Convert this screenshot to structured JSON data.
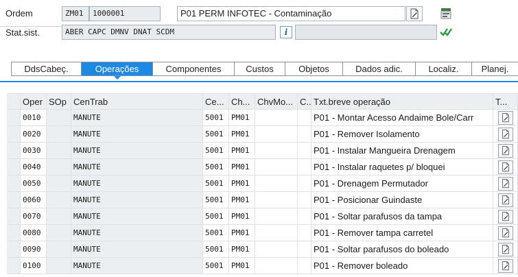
{
  "header": {
    "ordem_label": "Ordem",
    "order_type": "ZM01",
    "order_number": "1000001",
    "order_description": "P01 PERM INFOTEC - Contaminação",
    "status_label": "Stat.sist.",
    "system_status": "ABER CAPC DMNV DNAT SCDM",
    "info_icon_glyph": "i"
  },
  "tabs": [
    {
      "label": "DdsCabeç.",
      "active": false
    },
    {
      "label": "Operações",
      "active": true
    },
    {
      "label": "Componentes",
      "active": false
    },
    {
      "label": "Custos",
      "active": false
    },
    {
      "label": "Objetos",
      "active": false
    },
    {
      "label": "Dados adic.",
      "active": false
    },
    {
      "label": "Localiz.",
      "active": false
    },
    {
      "label": "Planej.",
      "active": false
    }
  ],
  "grid": {
    "columns": {
      "oper": "Oper",
      "sop": "SOp",
      "centrab": "CenTrab",
      "ce": "Ce...",
      "ch": "Ch...",
      "chvmo": "ChvMo...",
      "c": "C...",
      "txt": "Txt.breve operação",
      "t": "T..."
    },
    "rows": [
      {
        "oper": "0010",
        "centrab": "MANUTE",
        "ce": "5001",
        "ch": "PM01",
        "txt": "P01 - Montar Acesso Andaime Bole/Carr"
      },
      {
        "oper": "0020",
        "centrab": "MANUTE",
        "ce": "5001",
        "ch": "PM01",
        "txt": "P01 - Remover Isolamento"
      },
      {
        "oper": "0030",
        "centrab": "MANUTE",
        "ce": "5001",
        "ch": "PM01",
        "txt": "P01 - Instalar Mangueira Drenagem"
      },
      {
        "oper": "0040",
        "centrab": "MANUTE",
        "ce": "5001",
        "ch": "PM01",
        "txt": "P01 - Instalar raquetes p/ bloquei"
      },
      {
        "oper": "0050",
        "centrab": "MANUTE",
        "ce": "5001",
        "ch": "PM01",
        "txt": "P01 - Drenagem Permutador"
      },
      {
        "oper": "0060",
        "centrab": "MANUTE",
        "ce": "5001",
        "ch": "PM01",
        "txt": "P01 - Posicionar Guindaste"
      },
      {
        "oper": "0070",
        "centrab": "MANUTE",
        "ce": "5001",
        "ch": "PM01",
        "txt": "P01 - Soltar parafusos da tampa"
      },
      {
        "oper": "0080",
        "centrab": "MANUTE",
        "ce": "5001",
        "ch": "PM01",
        "txt": "P01 - Remover tampa carretel"
      },
      {
        "oper": "0090",
        "centrab": "MANUTE",
        "ce": "5001",
        "ch": "PM01",
        "txt": "P01 - Soltar parafusos do boleado"
      },
      {
        "oper": "0100",
        "centrab": "MANUTE",
        "ce": "5001",
        "ch": "PM01",
        "txt": "P01 - Remover boleado"
      }
    ]
  },
  "colors": {
    "accent": "#1e88e5",
    "grid_header_bg": "#eceff2",
    "check_green": "#2e9b3e"
  },
  "icons": {
    "long_text": "document-edit-icon",
    "status_detail": "status-flag-icon",
    "check": "checkmark-icon",
    "info": "info-icon"
  }
}
